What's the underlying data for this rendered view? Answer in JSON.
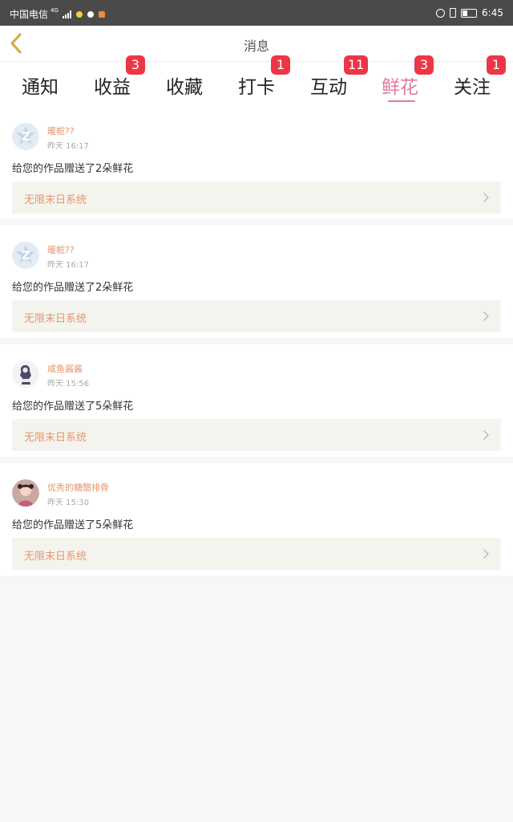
{
  "status_bar": {
    "carrier": "中国电信",
    "network": "4G",
    "time": "6:45"
  },
  "header": {
    "title": "消息"
  },
  "tabs": [
    {
      "label": "通知",
      "badge": null,
      "active": false
    },
    {
      "label": "收益",
      "badge": "3",
      "active": false
    },
    {
      "label": "收藏",
      "badge": null,
      "active": false
    },
    {
      "label": "打卡",
      "badge": "1",
      "active": false
    },
    {
      "label": "互动",
      "badge": "11",
      "active": false
    },
    {
      "label": "鲜花",
      "badge": "3",
      "active": true
    },
    {
      "label": "关注",
      "badge": "1",
      "active": false
    }
  ],
  "messages": [
    {
      "user": "暖栀??",
      "time": "昨天 16:17",
      "text": "给您的作品赠送了2朵鲜花",
      "work": "无限末日系统",
      "avatar": "default-avatar-icon"
    },
    {
      "user": "暖栀??",
      "time": "昨天 16:17",
      "text": "给您的作品赠送了2朵鲜花",
      "work": "无限末日系统",
      "avatar": "default-avatar-icon"
    },
    {
      "user": "咸鱼酱酱",
      "time": "昨天 15:56",
      "text": "给您的作品赠送了5朵鲜花",
      "work": "无限末日系统",
      "avatar": "user-avatar-anime"
    },
    {
      "user": "优秀的糖醋排骨",
      "time": "昨天 15:30",
      "text": "给您的作品赠送了5朵鲜花",
      "work": "无限末日系统",
      "avatar": "user-avatar-photo"
    }
  ],
  "colors": {
    "accent": "#e07a9f",
    "badge": "#ee3548",
    "name": "#e8956b",
    "statusbar": "#4a4a4a"
  }
}
